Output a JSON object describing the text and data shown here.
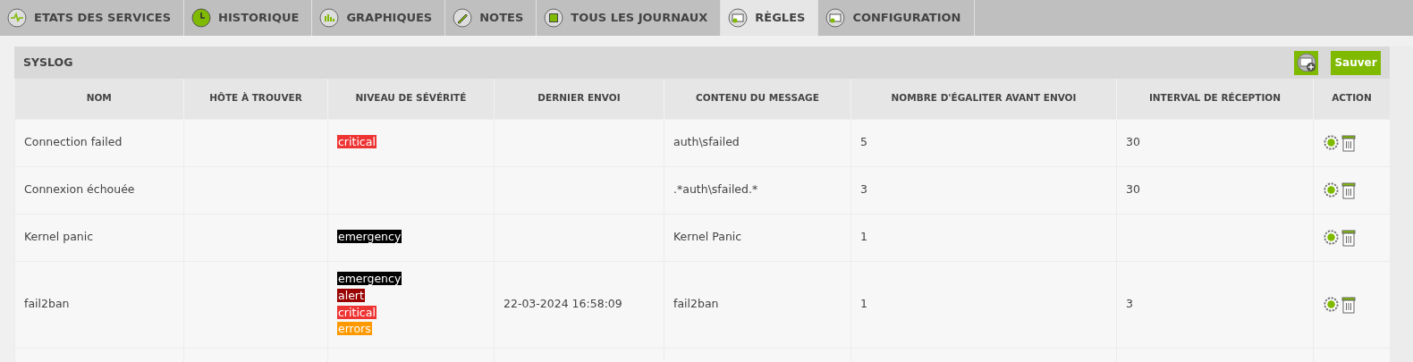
{
  "tabs": [
    {
      "label": "ETATS DES SERVICES",
      "selected": false
    },
    {
      "label": "HISTORIQUE",
      "selected": false
    },
    {
      "label": "GRAPHIQUES",
      "selected": false
    },
    {
      "label": "NOTES",
      "selected": false
    },
    {
      "label": "TOUS LES JOURNAUX",
      "selected": false
    },
    {
      "label": "RÈGLES",
      "selected": true
    },
    {
      "label": "CONFIGURATION",
      "selected": false
    }
  ],
  "panel": {
    "title": "SYSLOG",
    "save_button": "Sauver"
  },
  "table": {
    "columns": [
      "NOM",
      "HÔTE À TROUVER",
      "NIVEAU DE SÉVÉRITÉ",
      "DERNIER ENVOI",
      "CONTENU DU MESSAGE",
      "NOMBRE D'ÉGALITER AVANT ENVOI",
      "INTERVAL DE RÉCEPTION",
      "ACTION"
    ],
    "rows": [
      {
        "name": "Connection failed",
        "severities": [
          {
            "label": "critical",
            "color": "#ee3333"
          }
        ],
        "content": "auth\\sfailed",
        "count": "5",
        "interval": "30"
      },
      {
        "name": "Connexion échouée",
        "severities": [],
        "content": ".*auth\\sfailed.*",
        "count": "3",
        "interval": "30"
      },
      {
        "name": "Kernel panic",
        "severities": [
          {
            "label": "emergency",
            "color": "#000000"
          }
        ],
        "content": "Kernel Panic",
        "count": "1"
      },
      {
        "name": "fail2ban",
        "severities": [
          {
            "label": "emergency",
            "color": "#000000"
          },
          {
            "label": "alert",
            "color": "#990000"
          },
          {
            "label": "critical",
            "color": "#ee3333"
          },
          {
            "label": "errors",
            "color": "#ff9900"
          }
        ],
        "last_sent": "22-03-2024 16:58:09",
        "content": "fail2ban",
        "count": "1",
        "interval": "3"
      }
    ]
  }
}
